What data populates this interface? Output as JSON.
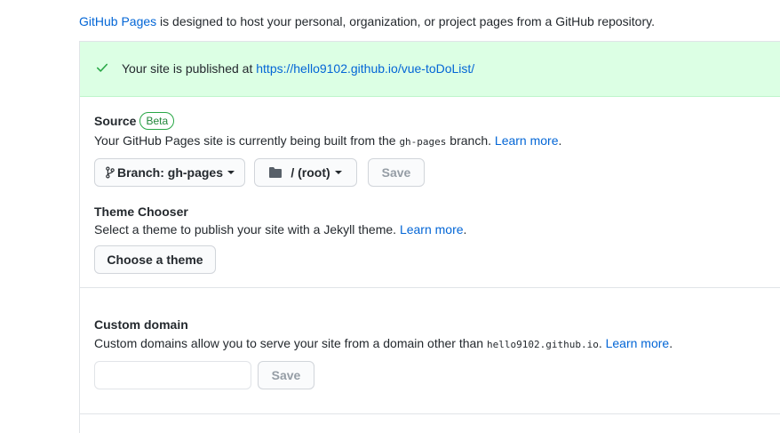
{
  "intro": {
    "link": "GitHub Pages",
    "text": " is designed to host your personal, organization, or project pages from a GitHub repository."
  },
  "flash": {
    "text": "Your site is published at ",
    "url": "https://hello9102.github.io/vue-toDoList/",
    "icon": "check-icon"
  },
  "source": {
    "title": "Source",
    "badge": "Beta",
    "desc_before": "Your GitHub Pages site is currently being built from the ",
    "branch_code": "gh-pages",
    "desc_after": " branch. ",
    "learn_more": "Learn more",
    "dot": ".",
    "branch_button": "Branch: gh-pages",
    "folder_button": "/ (root)",
    "save_button": "Save"
  },
  "theme": {
    "title": "Theme Chooser",
    "desc": "Select a theme to publish your site with a Jekyll theme. ",
    "learn_more": "Learn more",
    "dot": ".",
    "button": "Choose a theme"
  },
  "custom_domain": {
    "title": "Custom domain",
    "desc_before": "Custom domains allow you to serve your site from a domain other than ",
    "domain_code": "hello9102.github.io",
    "desc_after": ". ",
    "learn_more": "Learn more",
    "dot": ".",
    "input_value": "",
    "save_button": "Save"
  },
  "colors": {
    "link": "#0366d6",
    "flash_bg": "#dcffe4",
    "success": "#28a745"
  }
}
